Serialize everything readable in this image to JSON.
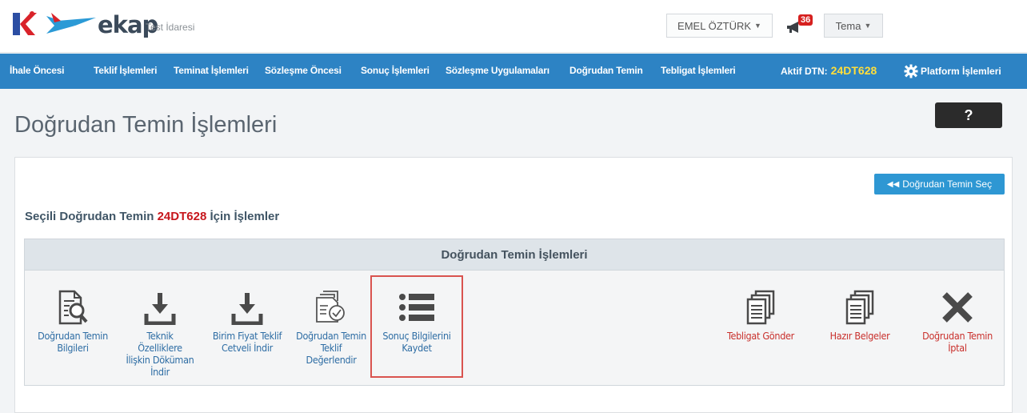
{
  "header": {
    "brand": "ekap",
    "org": "Test İdaresi",
    "user_name": "EMEL ÖZTÜRK",
    "notifications": "36",
    "theme_label": "Tema"
  },
  "nav": {
    "items": [
      "İhale Öncesi",
      "Teklif İşlemleri",
      "Teminat İşlemleri",
      "Sözleşme Öncesi",
      "Sonuç İşlemleri",
      "Sözleşme Uygulamaları",
      "Doğrudan Temin",
      "Tebligat İşlemleri"
    ],
    "active_label": "Aktif DTN:",
    "active_code": "24DT628",
    "platform_label": "Platform İşlemleri"
  },
  "page": {
    "title": "Doğrudan Temin İşlemleri",
    "help": "?",
    "select_button": "Doğrudan Temin Seç",
    "section_prefix": "Seçili Doğrudan Temin",
    "section_code": "24DT628",
    "section_suffix": "İçin İşlemler",
    "ops_header": "Doğrudan Temin İşlemleri"
  },
  "operations": [
    {
      "line1": "Doğrudan Temin",
      "line2": "Bilgileri",
      "icon": "document-search-icon"
    },
    {
      "line1": "Teknik",
      "line2": "Özelliklere",
      "line3": "İlişkin Döküman",
      "line4": "İndir",
      "icon": "download-icon"
    },
    {
      "line1": "Birim Fiyat Teklif",
      "line2": "Cetveli İndir",
      "icon": "download-icon"
    },
    {
      "line1": "Doğrudan Temin",
      "line2": "Teklif",
      "line3": "Değerlendir",
      "icon": "document-check-icon"
    },
    {
      "line1": "Sonuç Bilgilerini",
      "line2": "Kaydet",
      "icon": "list-icon"
    },
    {
      "line1": "Tebligat Gönder",
      "icon": "documents-icon"
    },
    {
      "line1": "Hazır Belgeler",
      "icon": "documents-icon"
    },
    {
      "line1": "Doğrudan Temin",
      "line2": "İptal",
      "icon": "cancel-icon"
    }
  ],
  "colors": {
    "nav_bg": "#2d83c4",
    "accent_yellow": "#ffde3b",
    "code_red": "#c7161c",
    "link_blue": "#2e6da4",
    "danger_red": "#c9302c"
  }
}
